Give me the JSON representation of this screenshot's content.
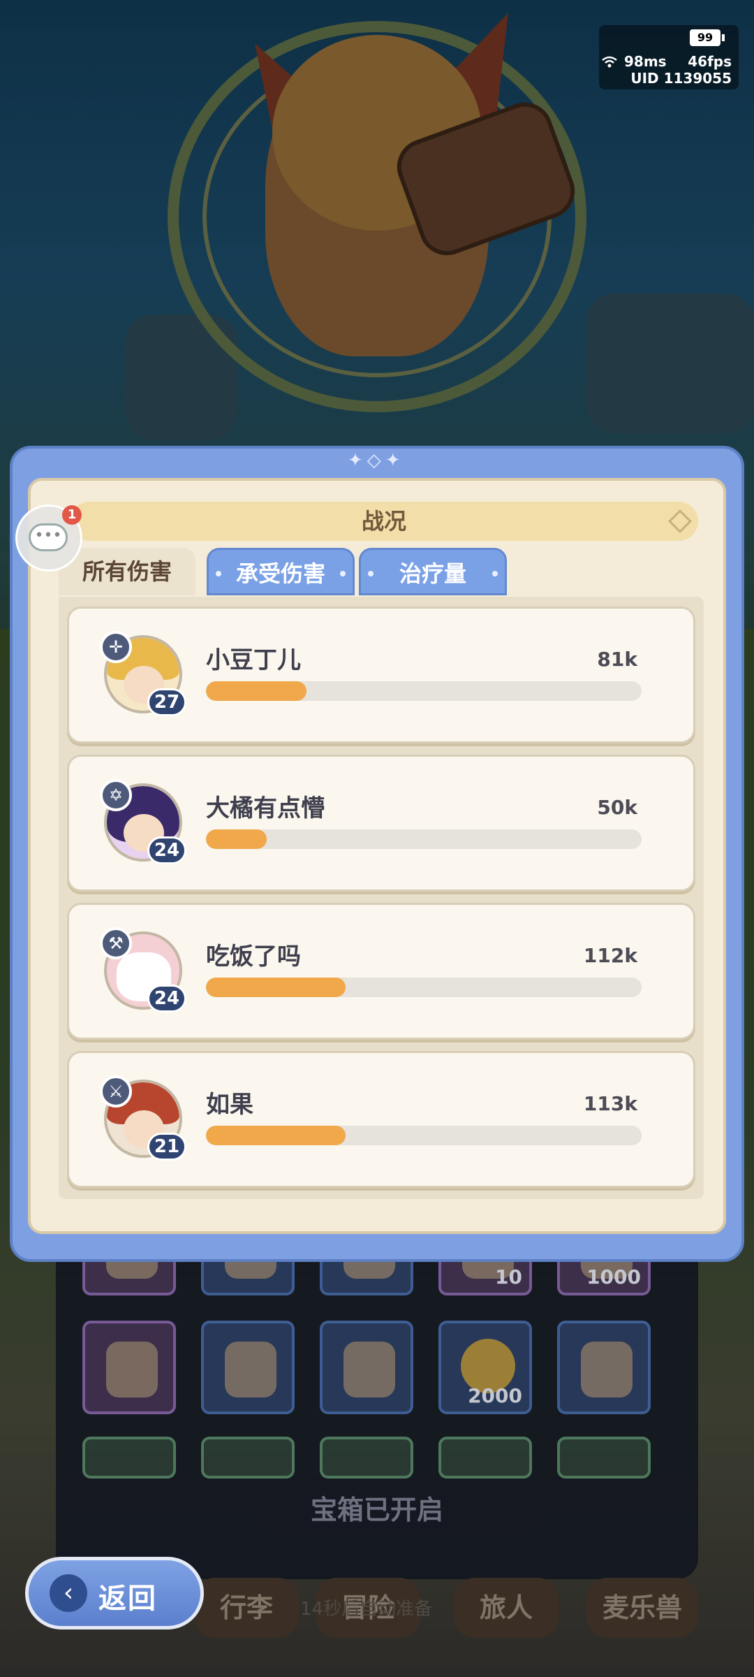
{
  "status": {
    "battery": "99",
    "ping": "98ms",
    "fps": "46fps",
    "uid": "UID 1139055"
  },
  "chat": {
    "badge": "1"
  },
  "panel": {
    "title": "战况",
    "tabs": [
      {
        "label": "所有伤害",
        "active": true
      },
      {
        "label": "承受伤害",
        "active": false
      },
      {
        "label": "治疗量",
        "active": false
      }
    ],
    "players": [
      {
        "name": "小豆丁儿",
        "value": "81k",
        "level": "27",
        "role_icon": "crosshair-icon",
        "fill": 0.23
      },
      {
        "name": "大橘有点懵",
        "value": "50k",
        "level": "24",
        "role_icon": "hexagram-icon",
        "fill": 0.14
      },
      {
        "name": "吃饭了吗",
        "value": "112k",
        "level": "24",
        "role_icon": "wrench-icon",
        "fill": 0.32
      },
      {
        "name": "如果",
        "value": "113k",
        "level": "21",
        "role_icon": "crossed-swords-icon",
        "fill": 0.32
      }
    ]
  },
  "inventory": {
    "counts": [
      "10",
      "1000",
      "2000"
    ],
    "chest_status": "宝箱已开启"
  },
  "bottom_tabs": [
    "行李",
    "冒险",
    "旅人",
    "麦乐兽"
  ],
  "tips": "14秒后自动准备",
  "back_button": {
    "label": "返回"
  },
  "colors": {
    "accent_blue": "#7ea0e3",
    "bar_orange": "#f0a84a",
    "panel_cream": "#f4ecd9"
  }
}
